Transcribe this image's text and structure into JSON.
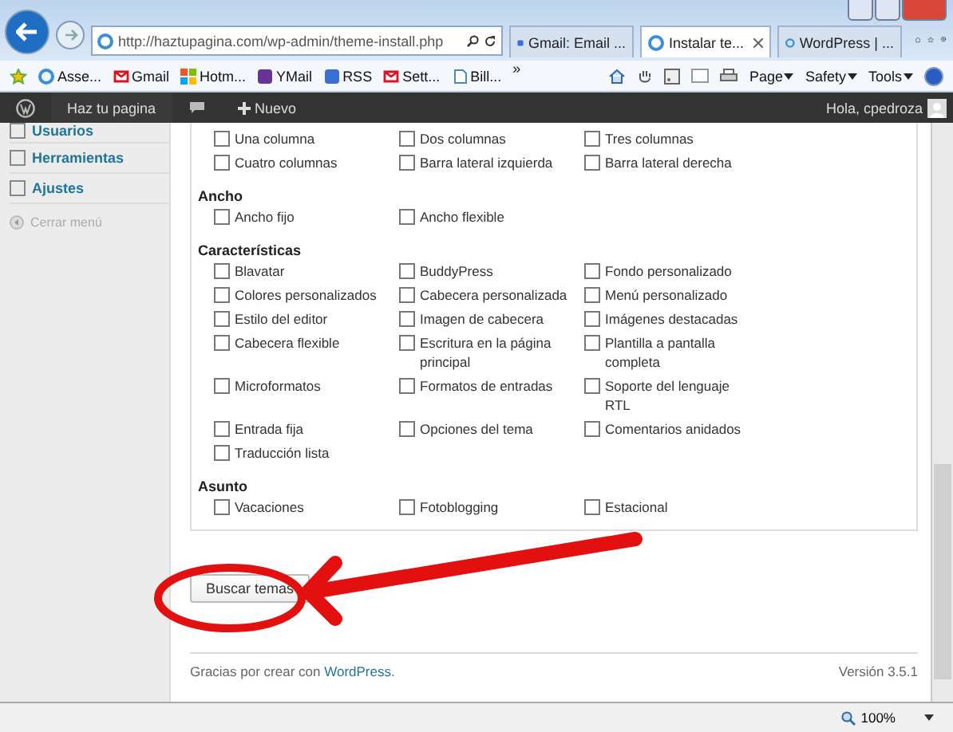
{
  "browser": {
    "address": "http://haztupagina.com/wp-admin/theme-install.php",
    "tabs": [
      {
        "label": "Gmail: Email ...",
        "selected": false,
        "kind": "g"
      },
      {
        "label": "Instalar te...",
        "selected": true,
        "kind": "e"
      },
      {
        "label": "WordPress | ...",
        "selected": false,
        "kind": "e"
      }
    ],
    "favorites": [
      {
        "label": "Asse...",
        "kind": "e"
      },
      {
        "label": "Gmail",
        "kind": "m"
      },
      {
        "label": "Hotm...",
        "kind": "w"
      },
      {
        "label": "YMail",
        "kind": "y"
      },
      {
        "label": "RSS",
        "kind": "g"
      },
      {
        "label": "Sett...",
        "kind": "m"
      },
      {
        "label": "Bill...",
        "kind": "d"
      }
    ],
    "chevron": "»",
    "commands": [
      "Page",
      "Safety",
      "Tools"
    ]
  },
  "admin_bar": {
    "site": "Haz tu pagina",
    "new": "Nuevo",
    "greeting": "Hola, cpedroza"
  },
  "sidebar": [
    {
      "label": "Usuarios",
      "kind": "menu"
    },
    {
      "label": "Herramientas",
      "kind": "menu"
    },
    {
      "label": "Ajustes",
      "kind": "menu"
    },
    {
      "label": "Cerrar menú",
      "kind": "collapse"
    }
  ],
  "filters": [
    {
      "options": [
        {
          "label": "Una columna",
          "checked": false
        },
        {
          "label": "Dos columnas",
          "checked": false
        },
        {
          "label": "Tres columnas",
          "checked": false
        },
        {
          "label": "Cuatro columnas",
          "checked": false
        },
        {
          "label": "Barra lateral izquierda",
          "checked": false
        },
        {
          "label": "Barra lateral derecha",
          "checked": false
        }
      ]
    },
    {
      "title": "Ancho",
      "options": [
        {
          "label": "Ancho fijo",
          "checked": false
        },
        {
          "label": "Ancho flexible",
          "checked": false
        }
      ]
    },
    {
      "title": "Características",
      "options": [
        {
          "label": "Blavatar",
          "checked": false
        },
        {
          "label": "BuddyPress",
          "checked": false
        },
        {
          "label": "Fondo personalizado",
          "checked": false
        },
        {
          "label": "Colores personalizados",
          "checked": false
        },
        {
          "label": "Cabecera personalizada",
          "checked": false
        },
        {
          "label": "Menú personalizado",
          "checked": false
        },
        {
          "label": "Estilo del editor",
          "checked": false
        },
        {
          "label": "Imagen de cabecera",
          "checked": false
        },
        {
          "label": "Imágenes destacadas",
          "checked": false
        },
        {
          "label": "Cabecera flexible",
          "checked": false
        },
        {
          "label": "Escritura en la página principal",
          "checked": false
        },
        {
          "label": "Plantilla a pantalla completa",
          "checked": false
        },
        {
          "label": "Microformatos",
          "checked": false
        },
        {
          "label": "Formatos de entradas",
          "checked": false
        },
        {
          "label": "Soporte del lenguaje RTL",
          "checked": false
        },
        {
          "label": "Entrada fija",
          "checked": false
        },
        {
          "label": "Opciones del tema",
          "checked": false
        },
        {
          "label": "Comentarios anidados",
          "checked": false
        },
        {
          "label": "Traducción lista",
          "checked": false
        }
      ]
    },
    {
      "title": "Asunto",
      "options": [
        {
          "label": "Vacaciones",
          "checked": false
        },
        {
          "label": "Fotoblogging",
          "checked": false
        },
        {
          "label": "Estacional",
          "checked": false
        }
      ]
    }
  ],
  "search_button": "Buscar temas",
  "footer": {
    "text": "Gracias por crear con",
    "link": "WordPress",
    "after": ".",
    "version": "Versión 3.5.1"
  },
  "status_bar": {
    "zoom": "100%"
  }
}
